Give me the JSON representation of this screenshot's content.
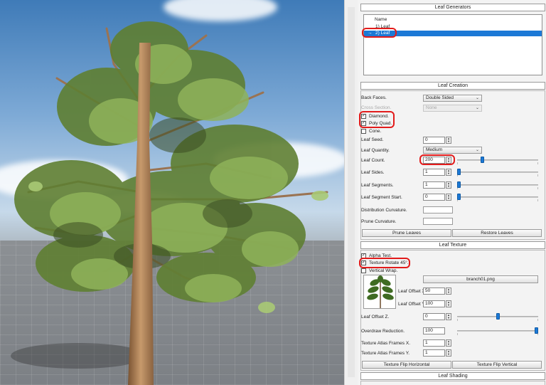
{
  "generators": {
    "title": "Leaf Generators",
    "column_header": "Name",
    "rows": [
      "1) Leaf",
      "2) Leaf"
    ],
    "selected_marker": "→"
  },
  "leaf_creation": {
    "title": "Leaf Creation",
    "back_faces_label": "Back Faces.",
    "back_faces_value": "Double Sided",
    "cross_section_label": "Cross Section.",
    "cross_section_value": "None",
    "diamond_label": "Diamond.",
    "poly_quad_label": "Poly Quad.",
    "cone_label": "Cone.",
    "leaf_seed_label": "Leaf Seed.",
    "leaf_seed_value": "0",
    "leaf_quantity_label": "Leaf Quantity.",
    "leaf_quantity_value": "Medium",
    "leaf_count_label": "Leaf Count.",
    "leaf_count_value": "200",
    "leaf_sides_label": "Leaf Sides.",
    "leaf_sides_value": "1",
    "leaf_segments_label": "Leaf Segments.",
    "leaf_segments_value": "1",
    "leaf_segment_start_label": "Leaf Segment Start.",
    "leaf_segment_start_value": "0",
    "distribution_curvature_label": "Distribution Curvature.",
    "prune_curvature_label": "Prune Curvature.",
    "prune_leaves_button": "Prune Leaves",
    "restore_leaves_button": "Restore Leaves"
  },
  "leaf_texture": {
    "title": "Leaf Texture",
    "alpha_test_label": "Alpha Test.",
    "texture_rotate_label": "Texture Rotate 45°.",
    "vertical_wrap_label": "Vertical Wrap.",
    "texture_file": "branch01.png",
    "leaf_offset_x_label": "Leaf Offset X.",
    "leaf_offset_x_value": "50",
    "leaf_offset_y_label": "Leaf Offset Y.",
    "leaf_offset_y_value": "100",
    "leaf_offset_z_label": "Leaf Offset Z.",
    "leaf_offset_z_value": "0",
    "overdraw_reduction_label": "Overdraw Reduction.",
    "overdraw_reduction_value": "100",
    "atlas_frames_x_label": "Texture Atlas Frames X.",
    "atlas_frames_x_value": "1",
    "atlas_frames_y_label": "Texture Atlas Frames Y.",
    "atlas_frames_y_value": "1",
    "flip_horizontal_button": "Texture Flip Horizontal",
    "flip_vertical_button": "Texture Flip Vertical"
  },
  "leaf_shading": {
    "title": "Leaf Shading"
  },
  "colors": {
    "accent": "#1c79d6",
    "highlight": "#e21b1b",
    "leaf_green": "#7fa84a",
    "trunk": "#b9875a"
  },
  "sliders": {
    "leaf_count": 0.3,
    "leaf_sides": 0.0,
    "leaf_segments": 0.0,
    "leaf_segment_start": 0.0,
    "leaf_offset_z": 0.5,
    "overdraw_reduction": 1.0
  }
}
